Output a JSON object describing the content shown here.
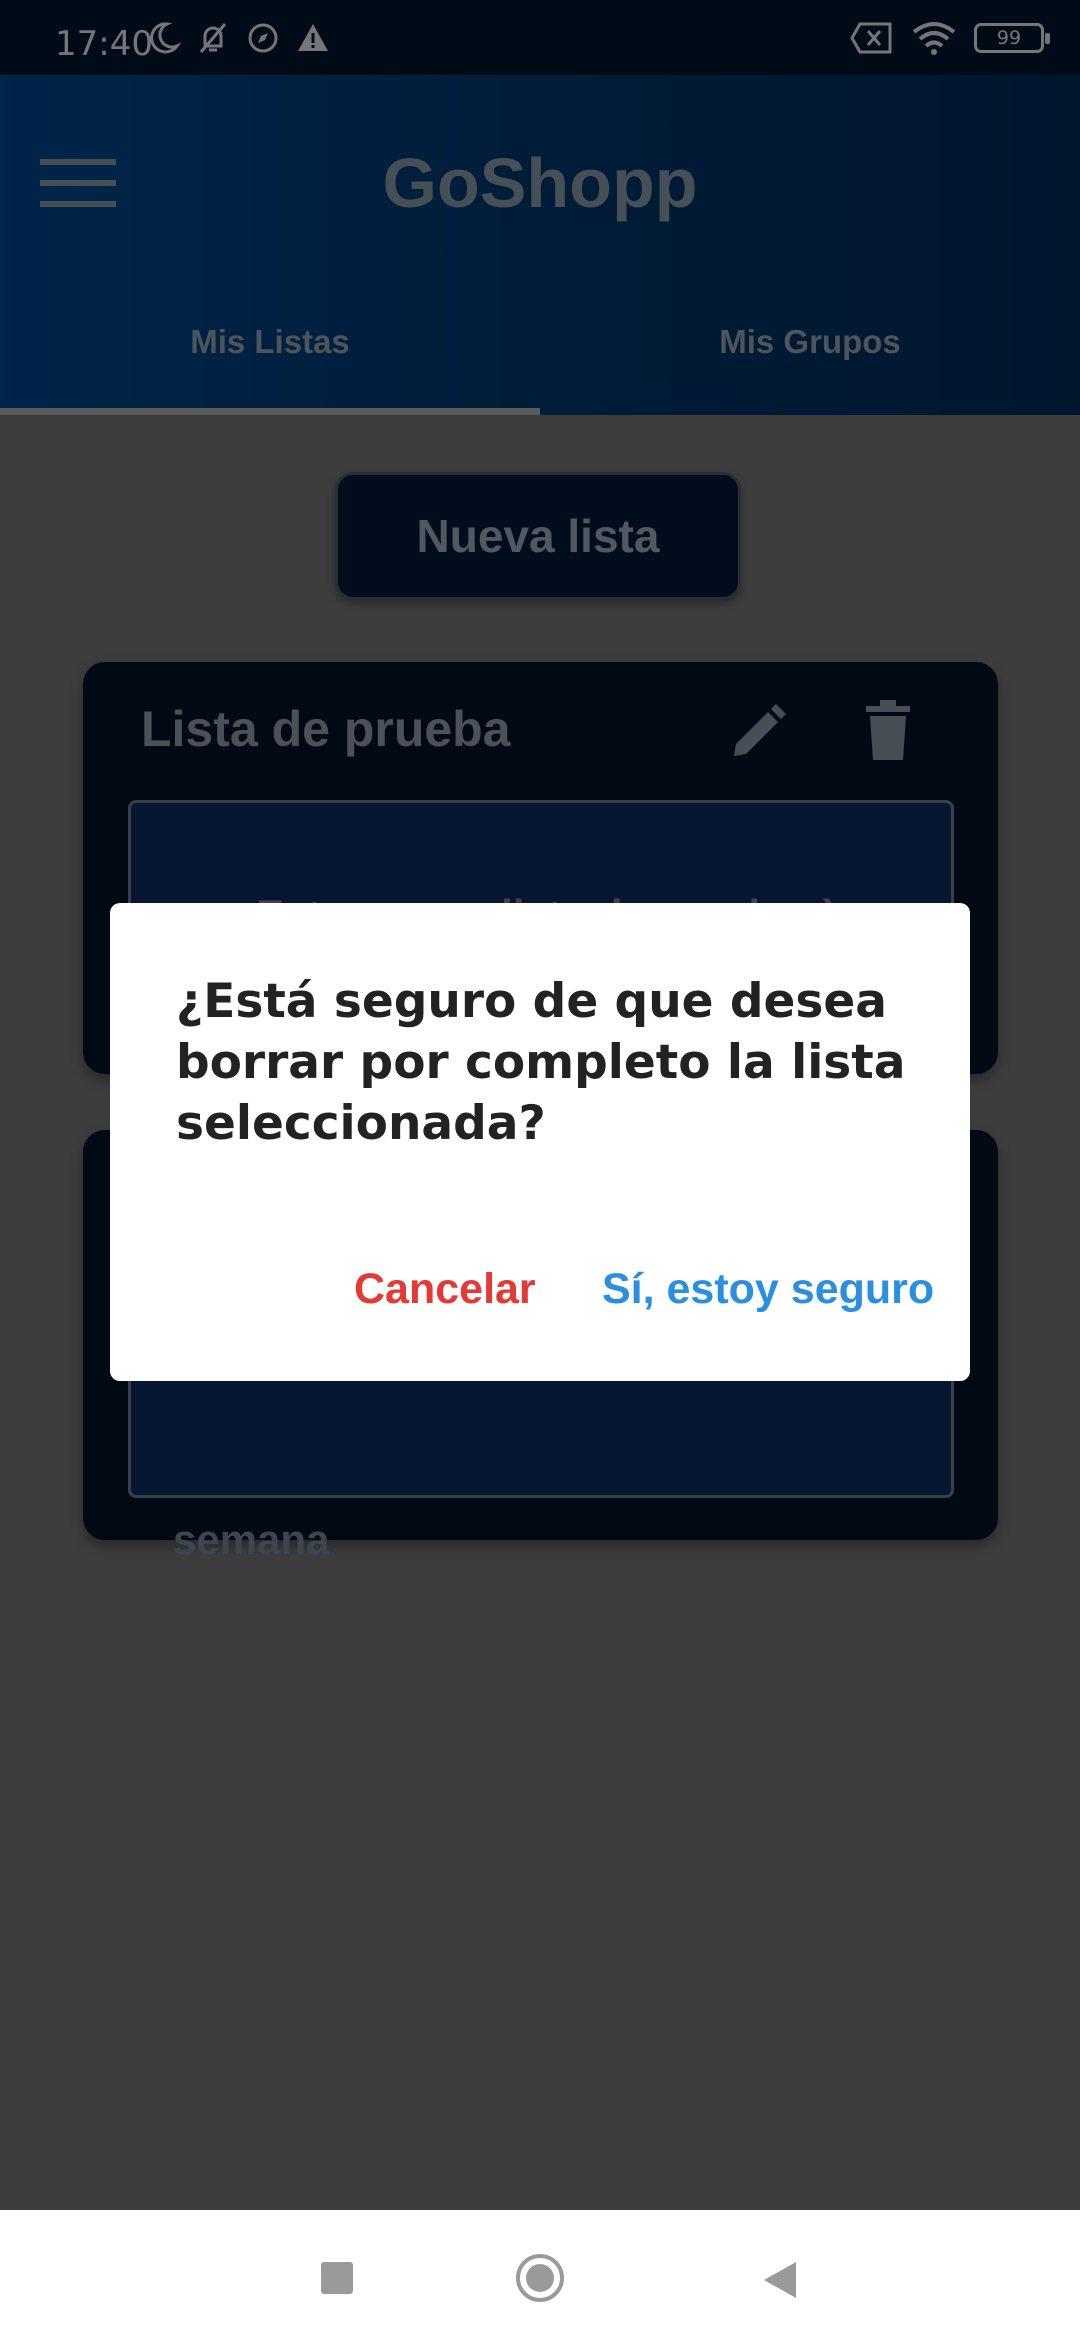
{
  "status_bar": {
    "time": "17:40",
    "battery": "99"
  },
  "app_bar": {
    "title": "GoShopp",
    "menu_icon": "hamburger-menu-icon"
  },
  "tabs": [
    {
      "label": "Mis Listas",
      "selected": true
    },
    {
      "label": "Mis Grupos",
      "selected": false
    }
  ],
  "new_list_button": {
    "label": "Nueva lista"
  },
  "cards": [
    {
      "title": "Lista de prueba",
      "description_partial": "Esta es una lista de prueba :)"
    },
    {
      "description_partial": "semana"
    }
  ],
  "dialog": {
    "message": "¿Está seguro de que desea borrar por completo la lista seleccionada?",
    "cancel_label": "Cancelar",
    "confirm_label": "Sí, estoy seguro",
    "cancel_color": "#e53935",
    "confirm_color": "#2a8fe0"
  },
  "colors": {
    "app_bar": "#023a74",
    "scrim": "rgba(0,0,0,0.5)",
    "card": "#02132b"
  }
}
